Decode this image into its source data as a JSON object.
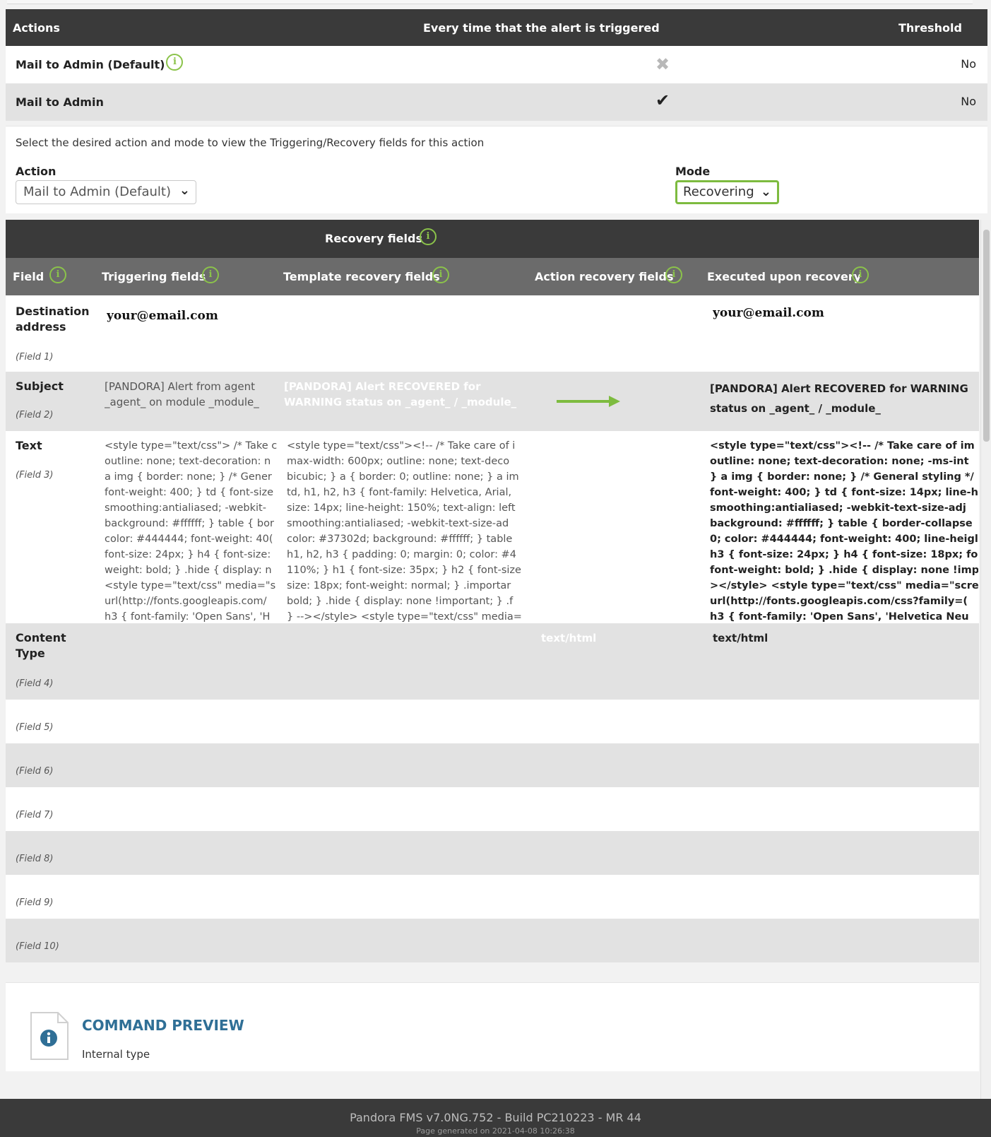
{
  "actions_table": {
    "headers": {
      "actions": "Actions",
      "every_time": "Every time that the alert is triggered",
      "threshold": "Threshold"
    },
    "rows": [
      {
        "name": "Mail to Admin (Default)",
        "every_time": "no",
        "threshold": "No"
      },
      {
        "name": "Mail to Admin",
        "every_time": "yes",
        "threshold": "No"
      }
    ]
  },
  "selector": {
    "lead": "Select the desired action and mode to view the Triggering/Recovery fields for this action",
    "action_label": "Action",
    "action_value": "Mail to Admin (Default)",
    "mode_label": "Mode",
    "mode_value": "Recovering"
  },
  "recovery_table": {
    "title": "Recovery fields",
    "columns": {
      "field": "Field",
      "triggering": "Triggering fields",
      "template_recovery": "Template recovery fields",
      "action_recovery": "Action recovery fields",
      "executed": "Executed upon recovery"
    },
    "rows": [
      {
        "name": "Destination address",
        "num": "(Field 1)",
        "triggering": "your@email.com",
        "template": "",
        "action": "",
        "executed": "your@email.com"
      },
      {
        "name": "Subject",
        "num": "(Field 2)",
        "triggering": "[PANDORA] Alert from agent _agent_ on module _module_",
        "template": "[PANDORA] Alert RECOVERED for WARNING status on _agent_ / _module_",
        "action": "",
        "executed": "[PANDORA] Alert RECOVERED for WARNING status on _agent_ / _module_"
      },
      {
        "name": "Text",
        "num": "(Field 3)",
        "triggering": [
          "<style type=\"text/css\"> /* Take c",
          "outline: none; text-decoration: n",
          "a img { border: none; } /* Gener",
          "font-weight: 400; } td { font-size",
          "smoothing:antialiased; -webkit-",
          "background: #ffffff; } table { bor",
          "color: #444444; font-weight: 40(",
          "font-size: 24px; } h4 { font-size:",
          "weight: bold; } .hide { display: n",
          "<style type=\"text/css\" media=\"s",
          "url(http://fonts.googleapis.com/",
          "h3 { font-family: 'Open Sans', 'H"
        ],
        "template": [
          "<style type=\"text/css\"><!-- /* Take care of i",
          "max-width: 600px; outline: none; text-deco",
          "bicubic; } a { border: 0; outline: none; } a im",
          "td, h1, h2, h3 { font-family: Helvetica, Arial,",
          "size: 14px; line-height: 150%; text-align: left",
          "smoothing:antialiased; -webkit-text-size-ad",
          "color: #37302d; background: #ffffff; } table",
          "h1, h2, h3 { padding: 0; margin: 0; color: #4",
          "110%; } h1 { font-size: 35px; } h2 { font-size",
          "size: 18px; font-weight: normal; } .importar",
          "bold; } .hide { display: none !important; } .f",
          "} --></style> <style type=\"text/css\" media=\""
        ],
        "action": "",
        "executed": [
          "<style type=\"text/css\"><!-- /* Take care of im",
          "outline: none; text-decoration: none; -ms-int",
          "} a img { border: none; } /* General styling */",
          "font-weight: 400; } td { font-size: 14px; line-h",
          "smoothing:antialiased; -webkit-text-size-adj",
          "background: #ffffff; } table { border-collapse",
          "0; color: #444444; font-weight: 400; line-heigl",
          "h3 { font-size: 24px; } h4 { font-size: 18px; fon",
          "font-weight: bold; } .hide { display: none !imp",
          "></style> <style type=\"text/css\" media=\"scre",
          "url(http://fonts.googleapis.com/css?family=(",
          "h3 { font-family: 'Open Sans', 'Helvetica Neu"
        ]
      },
      {
        "name": "Content Type",
        "num": "(Field 4)",
        "triggering": "",
        "template": "",
        "action": "text/html",
        "executed": "text/html"
      },
      {
        "name": "",
        "num": "(Field 5)"
      },
      {
        "name": "",
        "num": "(Field 6)"
      },
      {
        "name": "",
        "num": "(Field 7)"
      },
      {
        "name": "",
        "num": "(Field 8)"
      },
      {
        "name": "",
        "num": "(Field 9)"
      },
      {
        "name": "",
        "num": "(Field 10)"
      }
    ]
  },
  "command_preview": {
    "title": "COMMAND PREVIEW",
    "subtitle": "Internal type",
    "icon": "info-document-icon"
  },
  "footer": {
    "version": "Pandora FMS v7.0NG.752 - Build PC210223 - MR 44",
    "generated": "Page generated on 2021-04-08 10:26:38"
  },
  "colors": {
    "accent": "#8bc34a",
    "header_dark": "#3a3a3a",
    "header_mid": "#6b6b6b",
    "row_alt": "#e2e2e2",
    "title_blue": "#2f6f96"
  }
}
